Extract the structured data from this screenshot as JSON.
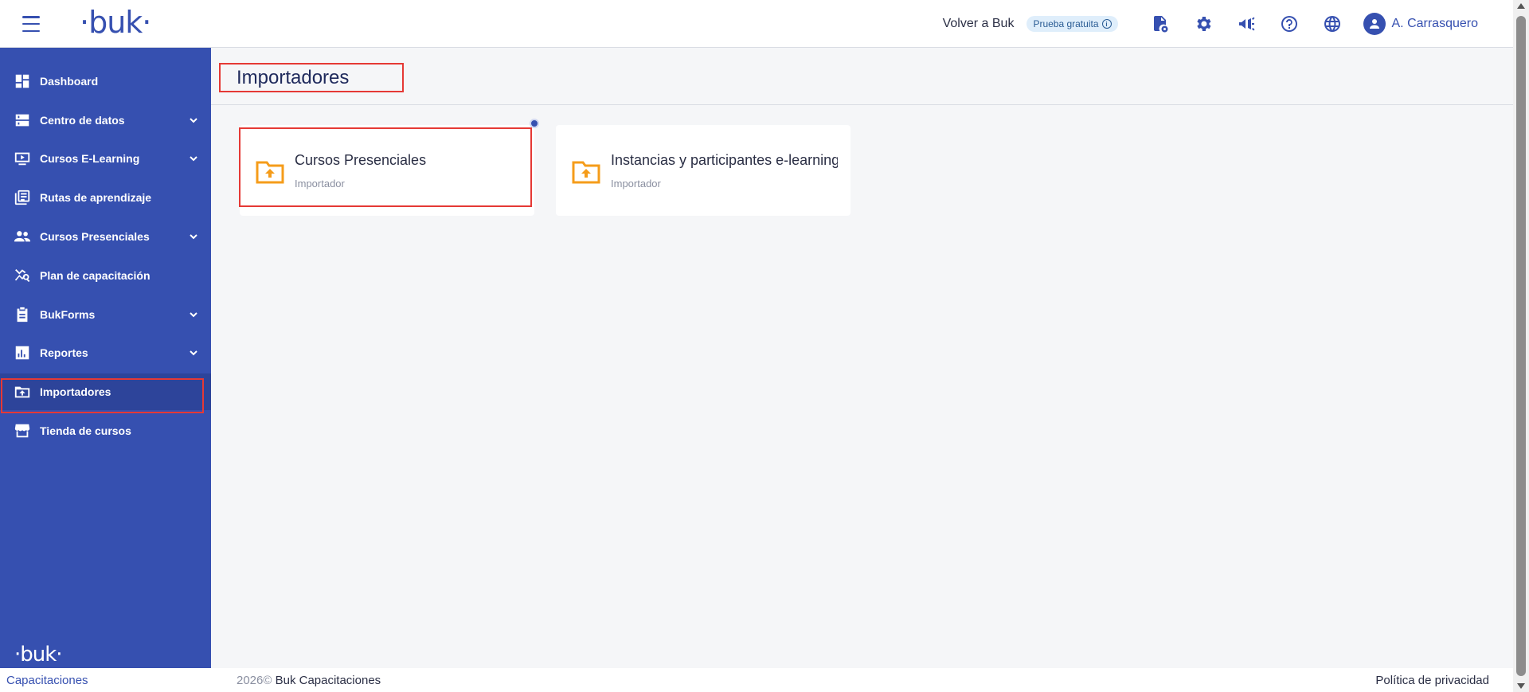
{
  "header": {
    "logo_text": "·buk·",
    "back_link": "Volver a Buk",
    "trial_badge": "Prueba gratuita",
    "trial_info_glyph": "i",
    "icons": [
      "document-gear-icon",
      "gear-icon",
      "megaphone-icon",
      "help-icon",
      "globe-icon"
    ],
    "user_name": "A. Carrasquero"
  },
  "sidebar": {
    "items": [
      {
        "label": "Dashboard",
        "icon": "dashboard-icon",
        "has_children": false
      },
      {
        "label": "Centro de datos",
        "icon": "server-icon",
        "has_children": true
      },
      {
        "label": "Cursos E-Learning",
        "icon": "monitor-play-icon",
        "has_children": true
      },
      {
        "label": "Rutas de aprendizaje",
        "icon": "library-icon",
        "has_children": false
      },
      {
        "label": "Cursos Presenciales",
        "icon": "people-icon",
        "has_children": true
      },
      {
        "label": "Plan de capacitación",
        "icon": "chart-search-icon",
        "has_children": false
      },
      {
        "label": "BukForms",
        "icon": "clipboard-icon",
        "has_children": true
      },
      {
        "label": "Reportes",
        "icon": "bar-chart-icon",
        "has_children": true
      },
      {
        "label": "Importadores",
        "icon": "folder-upload-icon",
        "has_children": false,
        "active": true
      },
      {
        "label": "Tienda de cursos",
        "icon": "store-icon",
        "has_children": false
      }
    ],
    "footer_logo": "·buk·"
  },
  "main": {
    "title": "Importadores",
    "cards": [
      {
        "title": "Cursos Presenciales",
        "subtitle": "Importador",
        "icon": "folder-upload-icon"
      },
      {
        "title": "Instancias y participantes e-learning",
        "subtitle": "Importador",
        "icon": "folder-upload-icon"
      }
    ]
  },
  "footer": {
    "app_name": "Capacitaciones",
    "year": "2026©",
    "company": "Buk Capacitaciones",
    "privacy": "Política de privacidad"
  },
  "colors": {
    "brand": "#3650b0",
    "sidebar_active": "#2d449a",
    "highlight": "#e53935",
    "folder_icon": "#f59c1a"
  }
}
